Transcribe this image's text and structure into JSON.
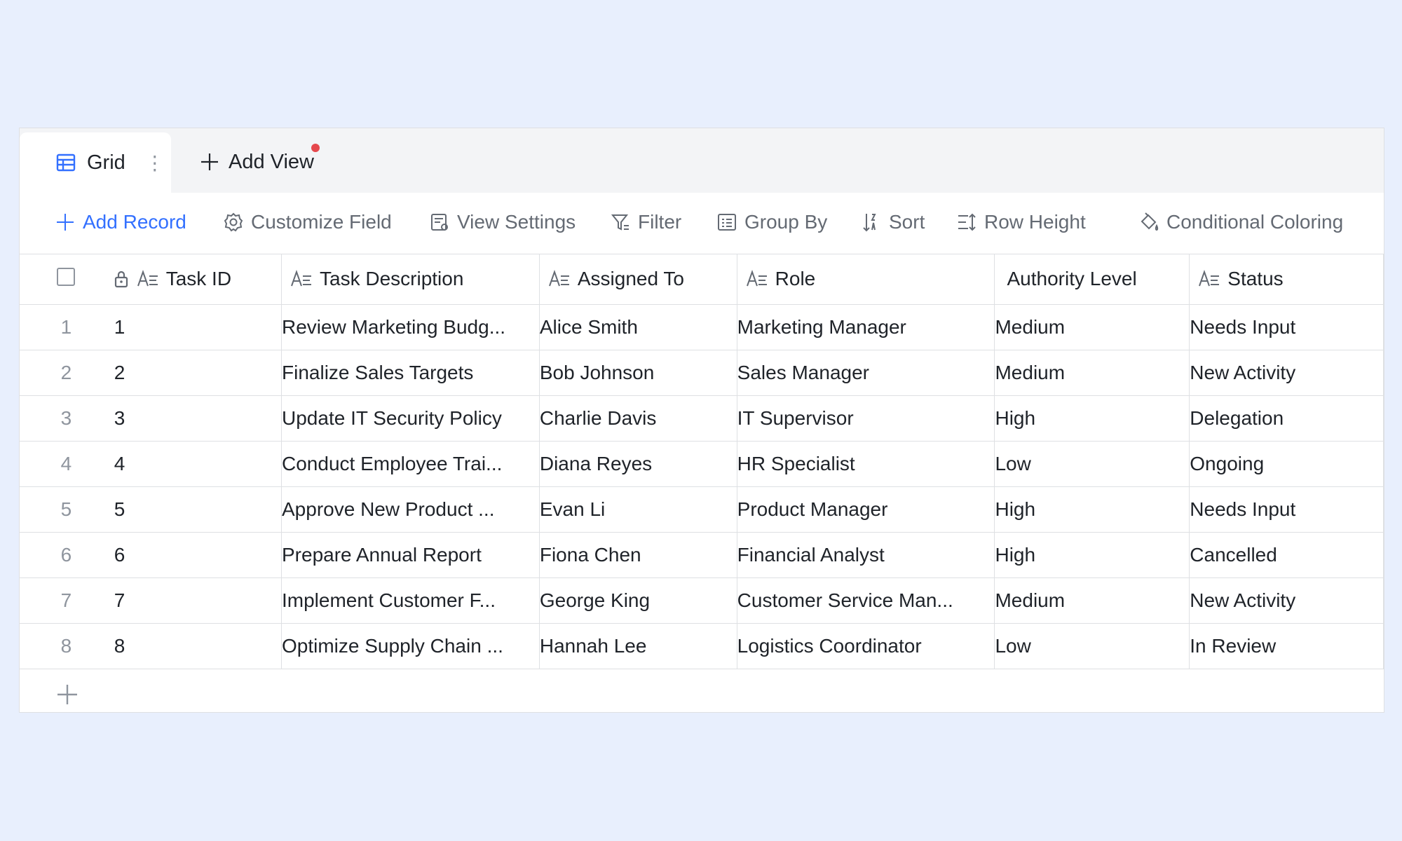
{
  "tabs": {
    "active": {
      "label": "Grid",
      "icon": "grid-table-icon"
    },
    "add_view_label": "Add View"
  },
  "toolbar": {
    "add_record": "Add Record",
    "customize_field": "Customize Field",
    "view_settings": "View Settings",
    "filter": "Filter",
    "group_by": "Group By",
    "sort": "Sort",
    "row_height": "Row Height",
    "conditional_coloring": "Conditional Coloring"
  },
  "table": {
    "columns": [
      {
        "label": "Task ID",
        "icon": "text-field-icon",
        "locked": true
      },
      {
        "label": "Task Description",
        "icon": "text-field-icon"
      },
      {
        "label": "Assigned To",
        "icon": "text-field-icon"
      },
      {
        "label": "Role",
        "icon": "text-field-icon"
      },
      {
        "label": "Authority Level",
        "icon": ""
      },
      {
        "label": "Status",
        "icon": "text-field-icon"
      }
    ],
    "rows": [
      {
        "num": "1",
        "id": "1",
        "desc": "Review Marketing Budg...",
        "assigned": "Alice Smith",
        "role": "Marketing Manager",
        "level": "Medium",
        "status": "Needs Input"
      },
      {
        "num": "2",
        "id": "2",
        "desc": "Finalize Sales Targets",
        "assigned": "Bob Johnson",
        "role": "Sales Manager",
        "level": "Medium",
        "status": "New Activity"
      },
      {
        "num": "3",
        "id": "3",
        "desc": "Update IT Security Policy",
        "assigned": "Charlie Davis",
        "role": "IT Supervisor",
        "level": "High",
        "status": "Delegation"
      },
      {
        "num": "4",
        "id": "4",
        "desc": "Conduct Employee Trai...",
        "assigned": "Diana Reyes",
        "role": "HR Specialist",
        "level": "Low",
        "status": "Ongoing"
      },
      {
        "num": "5",
        "id": "5",
        "desc": "Approve New Product ...",
        "assigned": "Evan Li",
        "role": "Product Manager",
        "level": "High",
        "status": "Needs Input"
      },
      {
        "num": "6",
        "id": "6",
        "desc": "Prepare Annual Report",
        "assigned": "Fiona Chen",
        "role": "Financial Analyst",
        "level": "High",
        "status": "Cancelled"
      },
      {
        "num": "7",
        "id": "7",
        "desc": "Implement Customer F...",
        "assigned": "George King",
        "role": "Customer Service Man...",
        "level": "Medium",
        "status": "New Activity"
      },
      {
        "num": "8",
        "id": "8",
        "desc": "Optimize Supply Chain ...",
        "assigned": "Hannah Lee",
        "role": "Logistics Coordinator",
        "level": "Low",
        "status": "In Review"
      }
    ]
  },
  "colors": {
    "accent": "#3370ff",
    "background": "#e8effd",
    "notify_dot": "#e5484d"
  }
}
